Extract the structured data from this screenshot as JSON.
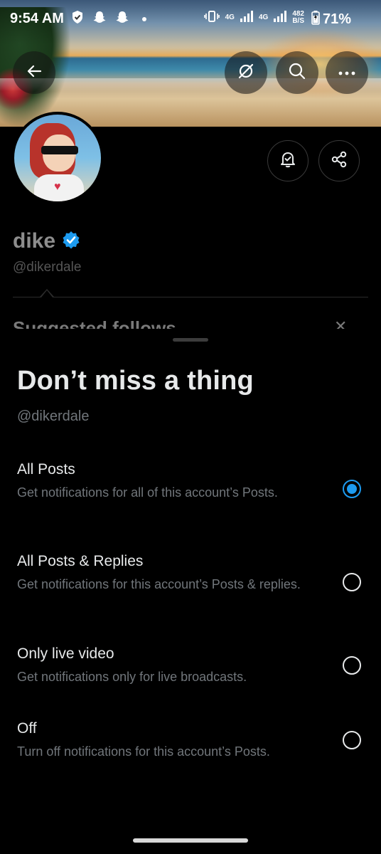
{
  "status_bar": {
    "time": "9:54 AM",
    "network_4g_a": "4G",
    "network_4g_b": "4G",
    "speed_value": "482",
    "speed_unit": "B/S",
    "battery": "71%"
  },
  "profile": {
    "display_name": "dike",
    "handle": "@dikerdale",
    "suggested_follows": "Suggested follows"
  },
  "sheet": {
    "title": "Don’t miss a thing",
    "handle": "@dikerdale",
    "options": [
      {
        "title": "All Posts",
        "description": "Get notifications for all of this account’s Posts.",
        "selected": true
      },
      {
        "title": "All Posts & Replies",
        "description": "Get notifications for this account’s Posts & replies.",
        "selected": false
      },
      {
        "title": "Only live video",
        "description": "Get notifications only for live broadcasts.",
        "selected": false
      },
      {
        "title": "Off",
        "description": "Turn off notifications for this account’s Posts.",
        "selected": false
      }
    ]
  },
  "colors": {
    "accent": "#1d9bf0",
    "verified": "#1d9bf0",
    "text_primary": "#e7e9ea",
    "text_secondary": "#71767b"
  },
  "icons": [
    "back-arrow-icon",
    "hide-icon",
    "search-icon",
    "more-icon",
    "notification-bell-icon",
    "share-icon",
    "verified-badge-icon",
    "close-icon"
  ]
}
